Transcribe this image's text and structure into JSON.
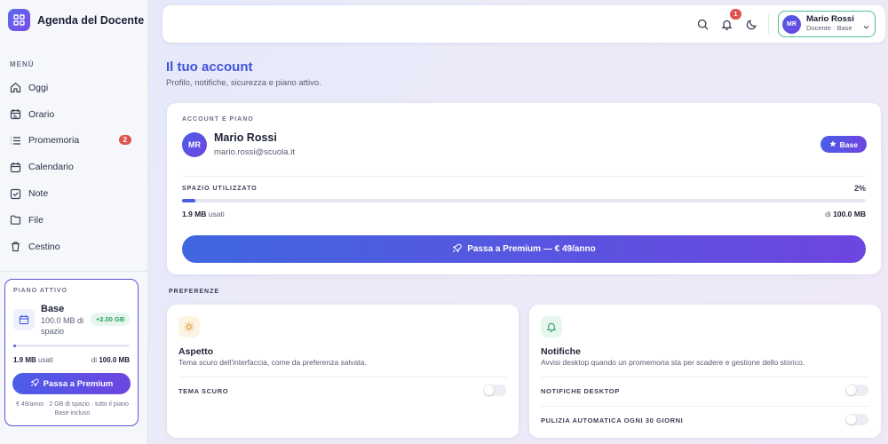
{
  "app": {
    "title": "Agenda del Docente"
  },
  "sidebar": {
    "menu_label": "MENÙ",
    "items": [
      {
        "label": "Oggi",
        "icon": "home-icon"
      },
      {
        "label": "Orario",
        "icon": "calendar-clock-icon"
      },
      {
        "label": "Promemoria",
        "icon": "list-icon",
        "badge": "2"
      },
      {
        "label": "Calendario",
        "icon": "calendar-icon"
      },
      {
        "label": "Note",
        "icon": "checkbox-icon"
      },
      {
        "label": "File",
        "icon": "folder-icon"
      },
      {
        "label": "Cestino",
        "icon": "trash-icon"
      }
    ],
    "plan": {
      "label": "PIANO ATTIVO",
      "name": "Base",
      "space": "100.0 MB di spazio",
      "extra": "+2.00 GB",
      "used_value": "1.9 MB",
      "used_suffix": "usati",
      "total_prefix": "di",
      "total_value": "100.0 MB",
      "usage_fraction": 0.02,
      "button": "Passa a Premium",
      "note": "€ 49/anno · 2 GB di spazio · tutto il piano Base incluso"
    }
  },
  "topbar": {
    "notifications_count": "1",
    "user": {
      "initials": "MR",
      "name": "Mario Rossi",
      "role": "Docente · Base"
    }
  },
  "page": {
    "title": "Il tuo account",
    "subtitle": "Profilo, notifiche, sicurezza e piano attivo."
  },
  "account": {
    "section_label": "ACCOUNT E PIANO",
    "initials": "MR",
    "name": "Mario Rossi",
    "email": "mario.rossi@scuola.it",
    "plan_badge": "Base",
    "space_label": "SPAZIO UTILIZZATO",
    "space_percent": "2%",
    "usage_fraction": 0.02,
    "used_value": "1.9 MB",
    "used_suffix": "usati",
    "total_prefix": "di",
    "total_value": "100.0 MB",
    "upgrade_button": "Passa a Premium — € 49/anno"
  },
  "preferences": {
    "section_label": "PREFERENZE",
    "appearance": {
      "title": "Aspetto",
      "description": "Tema scuro dell'interfaccia, come da preferenza salvata.",
      "rows": [
        {
          "label": "TEMA SCURO",
          "on": false
        }
      ]
    },
    "notifications": {
      "title": "Notifiche",
      "description": "Avvisi desktop quando un promemoria sta per scadere e gestione dello storico.",
      "rows": [
        {
          "label": "NOTIFICHE DESKTOP",
          "on": false
        },
        {
          "label": "PULIZIA AUTOMATICA OGNI 30 GIORNI",
          "on": false
        }
      ]
    }
  },
  "colors": {
    "accent": "#4b5de8",
    "accent2": "#6e45e0",
    "badge": "#e05353",
    "success": "#27a05f"
  }
}
